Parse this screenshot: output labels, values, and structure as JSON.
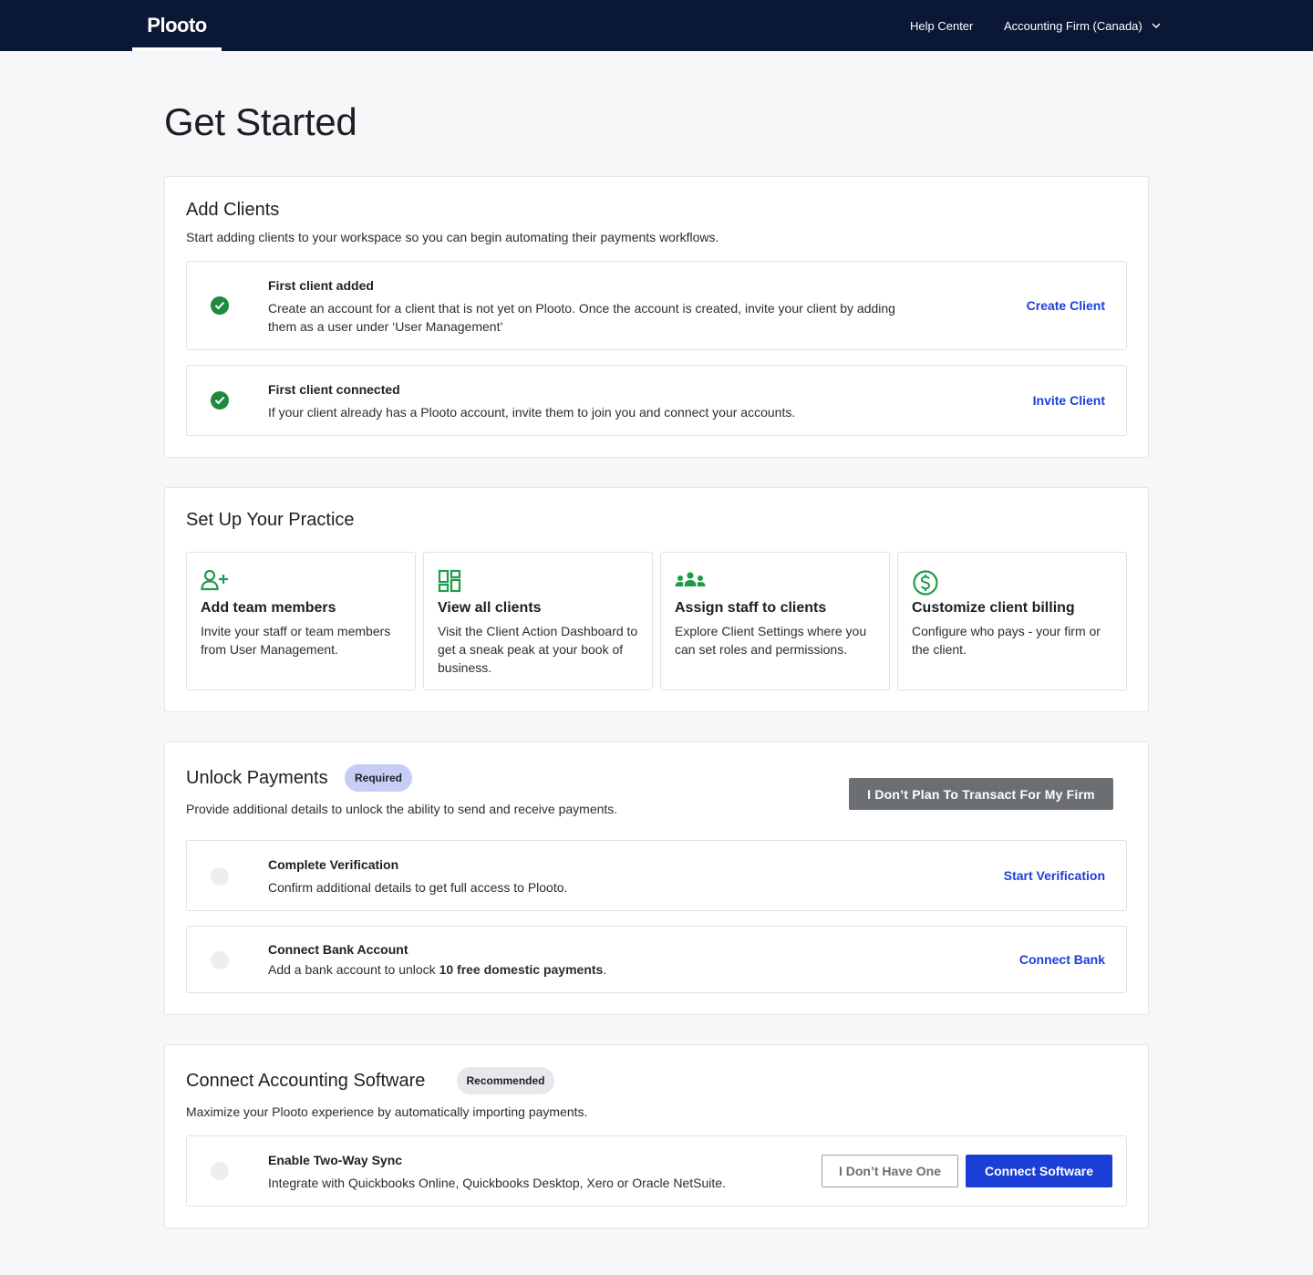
{
  "nav": {
    "logo": "Plooto",
    "help": "Help Center",
    "account": "Accounting Firm (Canada)"
  },
  "page": {
    "title": "Get Started"
  },
  "colors": {
    "nav_bg": "#0a1735",
    "accent": "#1b3fd6",
    "success": "#1f8a3c",
    "icon_green": "#1e9c4a"
  },
  "add_clients": {
    "title": "Add Clients",
    "subtitle": "Start adding clients to your workspace so you can begin automating their payments workflows.",
    "items": [
      {
        "title": "First client added",
        "desc_line1": "Create an account for a client that is not yet on Plooto. Once the account is created, invite your client by adding",
        "desc_line2": "them as a user under ‘User Management’",
        "action": "Create Client",
        "status": "complete"
      },
      {
        "title": "First client connected",
        "desc_line1": "If your client already has a Plooto account, invite them to join you and connect your accounts.",
        "action": "Invite Client",
        "status": "complete"
      }
    ]
  },
  "practice": {
    "title": "Set Up Your Practice",
    "tiles": [
      {
        "icon": "add-user-icon",
        "title": "Add team members",
        "desc": "Invite your staff or team members from User Management."
      },
      {
        "icon": "dashboard-icon",
        "title": "View all clients",
        "desc": "Visit the Client Action Dashboard to get a sneak peak at your book of business."
      },
      {
        "icon": "group-icon",
        "title": "Assign staff to clients",
        "desc": "Explore Client Settings where you can set roles and permissions."
      },
      {
        "icon": "dollar-icon",
        "title": "Customize client billing",
        "desc": "Configure who pays - your firm or the client."
      }
    ]
  },
  "payments": {
    "title": "Unlock Payments",
    "badge": "Required",
    "subtitle": "Provide additional details to unlock the ability to send and receive payments.",
    "opt_out": "I Don’t Plan To Transact For My Firm",
    "items": [
      {
        "title": "Complete Verification",
        "desc": "Confirm additional details to get full access to Plooto.",
        "action": "Start Verification",
        "status": "pending"
      },
      {
        "title": "Connect Bank Account",
        "desc_pre": "Add a bank account to unlock ",
        "desc_bold": "10 free domestic payments",
        "desc_post": ".",
        "action": "Connect Bank",
        "status": "pending"
      }
    ]
  },
  "software": {
    "title": "Connect Accounting Software",
    "badge": "Recommended",
    "subtitle": "Maximize your Plooto experience by automatically importing payments.",
    "item": {
      "title": "Enable Two-Way Sync",
      "desc": "Integrate with Quickbooks Online, Quickbooks Desktop, Xero or Oracle NetSuite.",
      "secondary": "I Don’t Have One",
      "primary": "Connect Software",
      "status": "pending"
    }
  }
}
